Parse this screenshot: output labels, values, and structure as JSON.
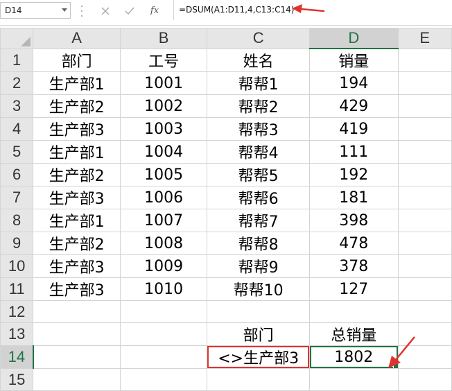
{
  "formula_bar": {
    "name_box": "D14",
    "cancel_icon": "close-icon",
    "enter_icon": "check-icon",
    "fx_label": "fx",
    "formula": "=DSUM(A1:D11,4,C13:C14)"
  },
  "columns": [
    "A",
    "B",
    "C",
    "D",
    "E"
  ],
  "rows": [
    {
      "num": "1",
      "cells": [
        "部门",
        "工号",
        "姓名",
        "销量",
        ""
      ]
    },
    {
      "num": "2",
      "cells": [
        "生产部1",
        "1001",
        "帮帮1",
        "194",
        ""
      ]
    },
    {
      "num": "3",
      "cells": [
        "生产部2",
        "1002",
        "帮帮2",
        "429",
        ""
      ]
    },
    {
      "num": "4",
      "cells": [
        "生产部3",
        "1003",
        "帮帮3",
        "419",
        ""
      ]
    },
    {
      "num": "5",
      "cells": [
        "生产部1",
        "1004",
        "帮帮4",
        "111",
        ""
      ]
    },
    {
      "num": "6",
      "cells": [
        "生产部2",
        "1005",
        "帮帮5",
        "192",
        ""
      ]
    },
    {
      "num": "7",
      "cells": [
        "生产部3",
        "1006",
        "帮帮6",
        "181",
        ""
      ]
    },
    {
      "num": "8",
      "cells": [
        "生产部1",
        "1007",
        "帮帮7",
        "398",
        ""
      ]
    },
    {
      "num": "9",
      "cells": [
        "生产部2",
        "1008",
        "帮帮8",
        "478",
        ""
      ]
    },
    {
      "num": "10",
      "cells": [
        "生产部3",
        "1009",
        "帮帮9",
        "378",
        ""
      ]
    },
    {
      "num": "11",
      "cells": [
        "生产部3",
        "1010",
        "帮帮10",
        "127",
        ""
      ]
    },
    {
      "num": "12",
      "cells": [
        "",
        "",
        "",
        "",
        ""
      ]
    },
    {
      "num": "13",
      "cells": [
        "",
        "",
        "部门",
        "总销量",
        ""
      ]
    },
    {
      "num": "14",
      "cells": [
        "",
        "",
        "<>生产部3",
        "1802",
        ""
      ]
    },
    {
      "num": "15",
      "cells": [
        "",
        "",
        "",
        "",
        ""
      ]
    }
  ],
  "selection": {
    "column": "D",
    "row": "14"
  },
  "colors": {
    "accent_green": "#217346",
    "annotation_red": "#e0332f",
    "header_bg": "#e6e6e6",
    "gridline": "#d4d4d4"
  }
}
